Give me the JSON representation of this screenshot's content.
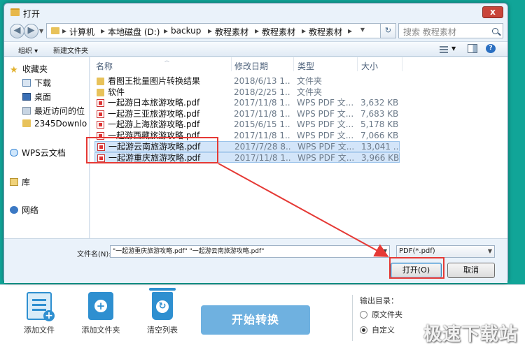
{
  "dialog": {
    "title": "打开",
    "close_label": "x",
    "breadcrumb": [
      "计算机",
      "本地磁盘 (D:)",
      "backup",
      "教程素材",
      "教程素材",
      "教程素材"
    ],
    "search_placeholder": "搜索 教程素材",
    "toolbar": {
      "organize": "组织 ▾",
      "new_folder": "新建文件夹"
    },
    "sidebar": {
      "favorites": "收藏夹",
      "downloads": "下载",
      "desktop": "桌面",
      "recent": "最近访问的位",
      "folder_2345": "2345Downlo",
      "wps_cloud": "WPS云文档",
      "library": "库",
      "network": "网络"
    },
    "columns": {
      "name": "名称",
      "date": "修改日期",
      "type": "类型",
      "size": "大小"
    },
    "files": [
      {
        "name": "看图王批量图片转换结果",
        "date": "2018/6/13 1...",
        "type": "文件夹",
        "size": "",
        "kind": "folder",
        "selected": false
      },
      {
        "name": "软件",
        "date": "2018/2/25 1...",
        "type": "文件夹",
        "size": "",
        "kind": "folder",
        "selected": false
      },
      {
        "name": "一起游日本旅游攻略.pdf",
        "date": "2017/11/8 1...",
        "type": "WPS PDF 文...",
        "size": "3,632 KB",
        "kind": "pdf",
        "selected": false
      },
      {
        "name": "一起游三亚旅游攻略.pdf",
        "date": "2017/11/8 1...",
        "type": "WPS PDF 文...",
        "size": "7,683 KB",
        "kind": "pdf",
        "selected": false
      },
      {
        "name": "一起游上海旅游攻略.pdf",
        "date": "2015/6/15 1...",
        "type": "WPS PDF 文...",
        "size": "5,178 KB",
        "kind": "pdf",
        "selected": false
      },
      {
        "name": "一起游西藏旅游攻略.pdf",
        "date": "2017/11/8 1...",
        "type": "WPS PDF 文...",
        "size": "7,066 KB",
        "kind": "pdf",
        "selected": false
      },
      {
        "name": "一起游云南旅游攻略.pdf",
        "date": "2017/7/28 8...",
        "type": "WPS PDF 文...",
        "size": "13,041 ...",
        "kind": "pdf",
        "selected": true
      },
      {
        "name": "一起游重庆旅游攻略.pdf",
        "date": "2017/11/8 1...",
        "type": "WPS PDF 文...",
        "size": "3,966 KB",
        "kind": "pdf",
        "selected": true
      }
    ],
    "filename_label": "文件名(N):",
    "filename_value": "\"一起游重庆旅游攻略.pdf\" \"一起游云南旅游攻略.pdf\"",
    "filter_value": "PDF(*.pdf)",
    "open_label": "打开(O)",
    "cancel_label": "取消"
  },
  "app": {
    "add_file": "添加文件",
    "add_folder": "添加文件夹",
    "clear_list": "清空列表",
    "convert": "开始转换",
    "output_dir_label": "输出目录：",
    "output_options": [
      "原文件夹",
      "自定义"
    ],
    "output_selected": 1,
    "watermark": "极速下载站"
  },
  "annotation_color": "#e53935"
}
